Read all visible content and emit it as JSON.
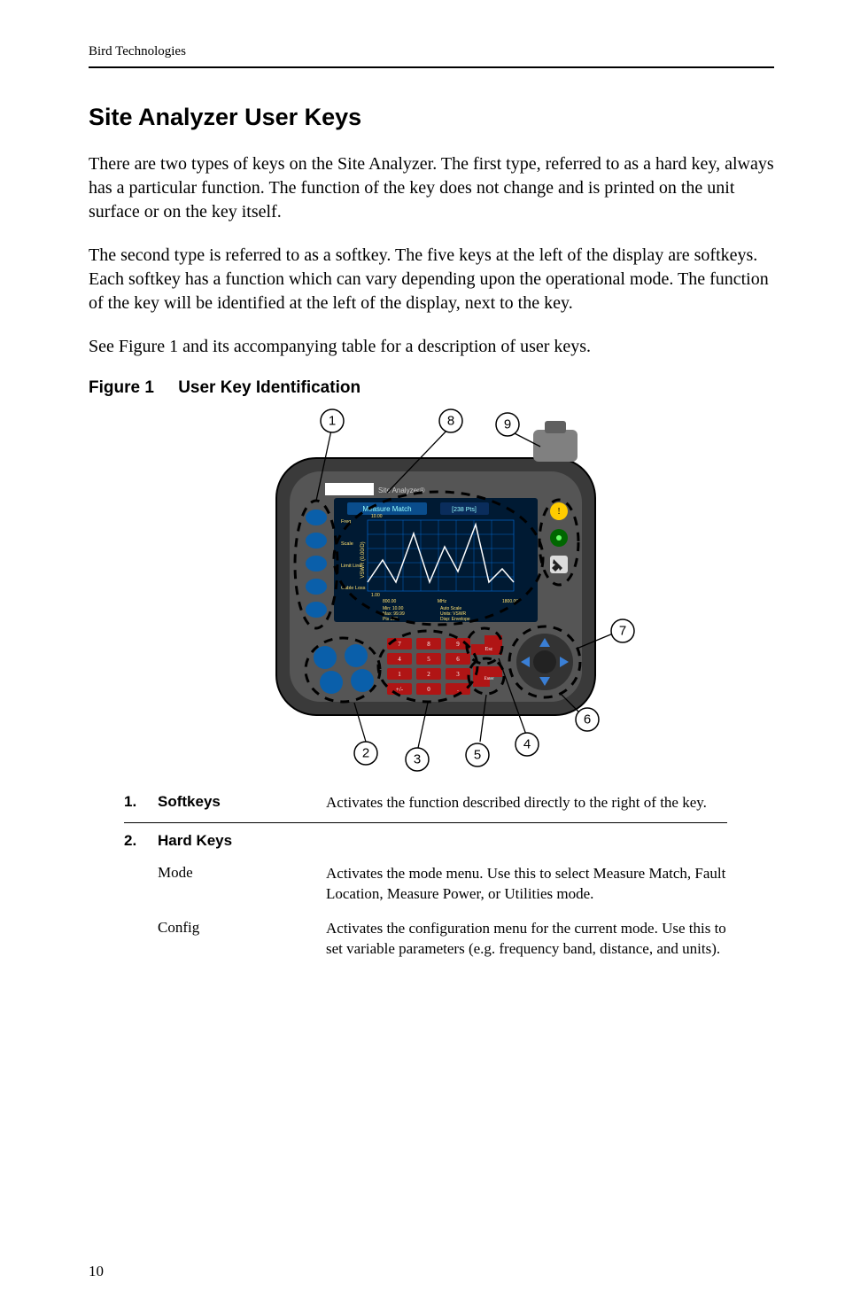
{
  "header": "Bird Technologies",
  "heading": "Site Analyzer User Keys",
  "paragraphs": {
    "p1": "There are two types of keys on the Site Analyzer. The first type, referred to as a hard key, always has a particular function. The function of the key does not change and is printed on the unit surface or on the key itself.",
    "p2": "The second type is referred to as a softkey. The five keys at the left of the display are softkeys. Each softkey has a function which can vary depending upon the operational mode. The function of the key will be identified at the left of the display, next to the key.",
    "p3": "See Figure 1 and its accompanying table for a description of user keys."
  },
  "figure": {
    "label": "Figure 1",
    "title": "User Key Identification"
  },
  "rows": {
    "r1": {
      "num": "1.",
      "label": "Softkeys",
      "desc": "Activates the function described directly to the right of the key."
    },
    "r2": {
      "num": "2.",
      "label": "Hard Keys",
      "desc": ""
    },
    "r2a": {
      "label": "Mode",
      "desc": "Activates the mode menu. Use this to select Measure Match, Fault Location, Measure Power, or Utilities mode."
    },
    "r2b": {
      "label": "Config",
      "desc": "Activates the configuration menu for the current mode. Use this to set variable parameters (e.g. frequency band, distance, and units)."
    }
  },
  "callouts": {
    "c1": "1",
    "c2": "2",
    "c3": "3",
    "c4": "4",
    "c5": "5",
    "c6": "6",
    "c7": "7",
    "c8": "8",
    "c9": "9"
  },
  "device_screen": {
    "title": "Measure Match",
    "pts": "[238 Pts]",
    "labels": {
      "freq": "Freq",
      "scale": "Scale",
      "limit": "Limit Line",
      "cable": "Cable Loss"
    },
    "readouts": {
      "ytop": "10.00",
      "ybot": "1.00",
      "xl": "800.00",
      "xr": "1800.00",
      "xlabel": "MHz",
      "min": "Min: 10.00",
      "max": "Max: 99.99",
      "pts": "Pts  238",
      "auto": "Auto Scale",
      "units": "Units: VSWR",
      "disp": "Disp: Envelope"
    }
  },
  "pagenum": "10"
}
